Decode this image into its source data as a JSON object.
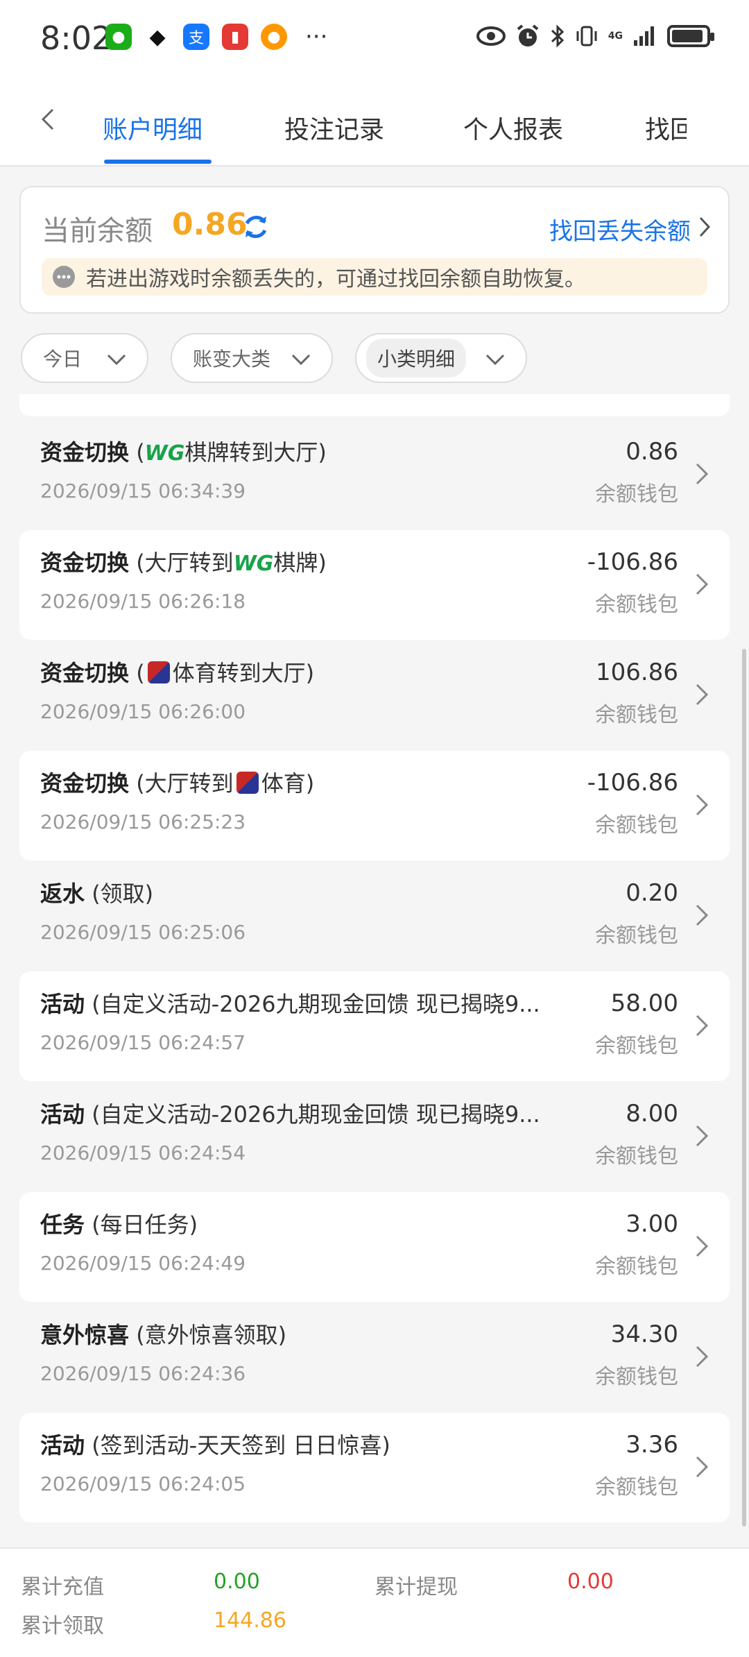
{
  "status_bar": {
    "time": "8:02",
    "network": "4G",
    "icons": [
      "wechat-icon",
      "qq-icon",
      "alipay-icon",
      "book-app-icon",
      "game-app-icon",
      "more-dots-icon",
      "eye-icon",
      "alarm-icon",
      "bluetooth-icon",
      "vibrate-icon",
      "signal-icon",
      "battery-icon"
    ]
  },
  "tabs": [
    {
      "label": "账户明细",
      "active": true
    },
    {
      "label": "投注记录",
      "active": false
    },
    {
      "label": "个人报表",
      "active": false
    },
    {
      "label": "找回",
      "active": false
    }
  ],
  "balance": {
    "label": "当前余额",
    "value": "0.86",
    "recover_link": "找回丢失余额",
    "notice": "若进出游戏时余额丢失的，可通过找回余额自助恢复。"
  },
  "filters": {
    "date": "今日",
    "category": "账变大类",
    "subcategory": "小类明细"
  },
  "transactions": [
    {
      "type": "资金切换",
      "detail_pre": "(",
      "brand": "WG",
      "detail_post": "棋牌转到大厅)",
      "date": "2026/09/15 06:34:39",
      "amount": "0.86",
      "wallet": "余额钱包"
    },
    {
      "type": "资金切换",
      "detail_pre": "(大厅转到",
      "brand": "WG",
      "detail_post": "棋牌)",
      "date": "2026/09/15 06:26:18",
      "amount": "-106.86",
      "wallet": "余额钱包"
    },
    {
      "type": "资金切换",
      "detail_pre": "(",
      "brand": "IM",
      "detail_post": "体育转到大厅)",
      "date": "2026/09/15 06:26:00",
      "amount": "106.86",
      "wallet": "余额钱包"
    },
    {
      "type": "资金切换",
      "detail_pre": "(大厅转到",
      "brand": "IM",
      "detail_post": "体育)",
      "date": "2026/09/15 06:25:23",
      "amount": "-106.86",
      "wallet": "余额钱包"
    },
    {
      "type": "返水",
      "detail_pre": "(领取)",
      "brand": "",
      "detail_post": "",
      "date": "2026/09/15 06:25:06",
      "amount": "0.20",
      "wallet": "余额钱包"
    },
    {
      "type": "活动",
      "detail_pre": "(自定义活动-2026九期现金回馈 现已揭晓9...",
      "brand": "",
      "detail_post": "",
      "date": "2026/09/15 06:24:57",
      "amount": "58.00",
      "wallet": "余额钱包"
    },
    {
      "type": "活动",
      "detail_pre": "(自定义活动-2026九期现金回馈 现已揭晓9...",
      "brand": "",
      "detail_post": "",
      "date": "2026/09/15 06:24:54",
      "amount": "8.00",
      "wallet": "余额钱包"
    },
    {
      "type": "任务",
      "detail_pre": "(每日任务)",
      "brand": "",
      "detail_post": "",
      "date": "2026/09/15 06:24:49",
      "amount": "3.00",
      "wallet": "余额钱包"
    },
    {
      "type": "意外惊喜",
      "detail_pre": "(意外惊喜领取)",
      "brand": "",
      "detail_post": "",
      "date": "2026/09/15 06:24:36",
      "amount": "34.30",
      "wallet": "余额钱包"
    },
    {
      "type": "活动",
      "detail_pre": "(签到活动-天天签到 日日惊喜)",
      "brand": "",
      "detail_post": "",
      "date": "2026/09/15 06:24:05",
      "amount": "3.36",
      "wallet": "余额钱包"
    }
  ],
  "summary": {
    "recharge_label": "累计充值",
    "recharge_value": "0.00",
    "withdraw_label": "累计提现",
    "withdraw_value": "0.00",
    "claim_label": "累计领取",
    "claim_value": "144.86"
  },
  "colors": {
    "accent": "#1a73e8",
    "balance": "#f5a623",
    "positive": "#22a322",
    "negative": "#e53935",
    "claim": "#f5a623"
  }
}
